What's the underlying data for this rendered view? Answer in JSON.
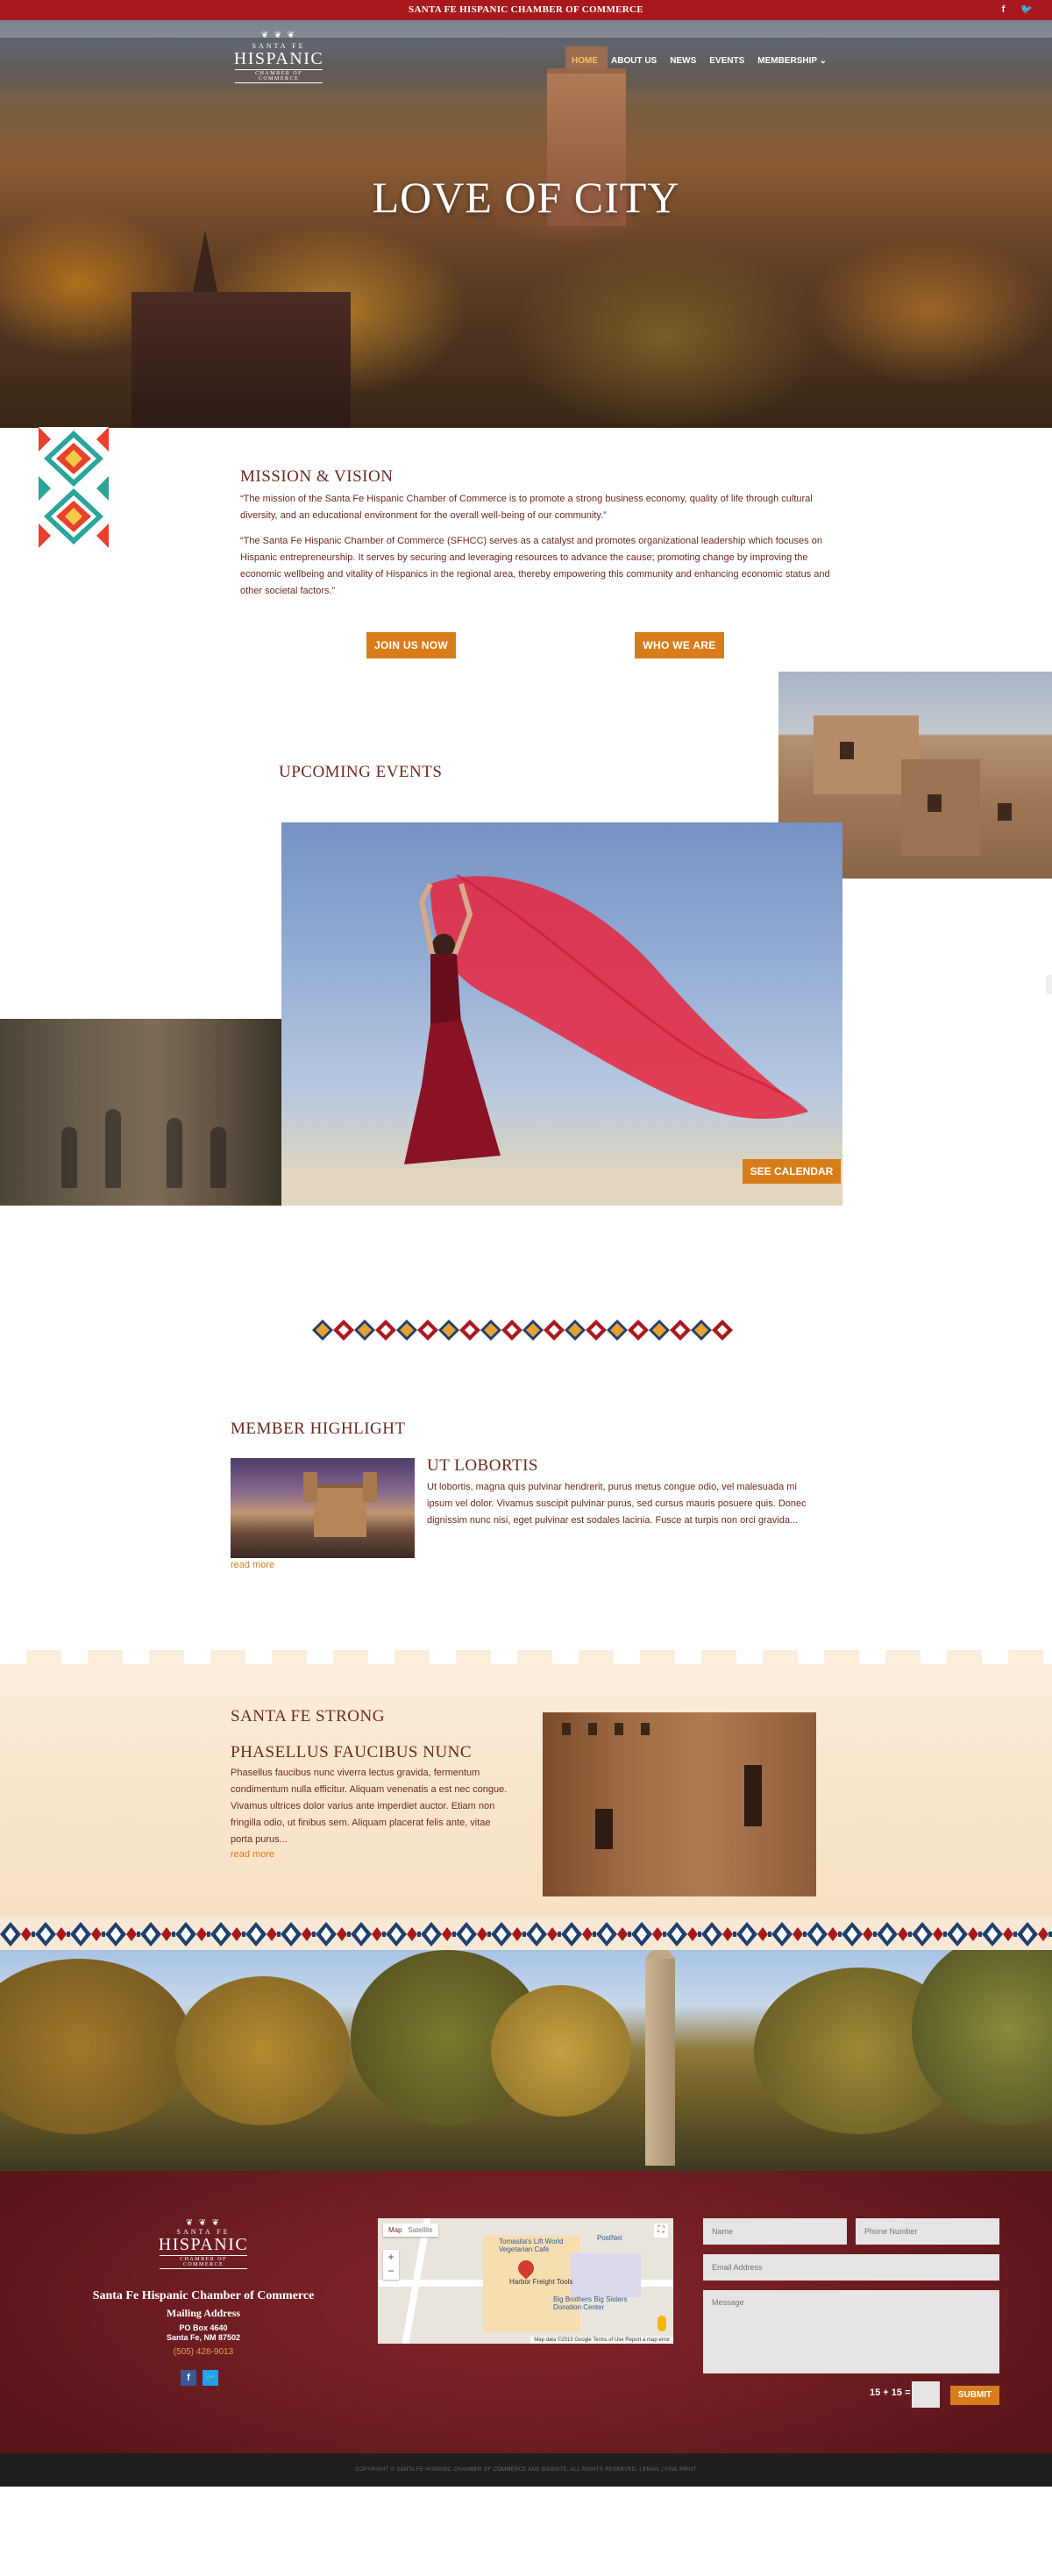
{
  "topbar": {
    "title": "SANTA FE HISPANIC CHAMBER OF COMMERCE",
    "facebook_icon": "f",
    "twitter_icon": "🐦"
  },
  "logo": {
    "ornament": "❦ ❦ ❦",
    "line1": "SANTA FE",
    "line2": "HISPANIC",
    "line3": "CHAMBER OF COMMERCE"
  },
  "nav": {
    "items": [
      "HOME",
      "ABOUT US",
      "NEWS",
      "EVENTS",
      "MEMBERSHIP ⌄"
    ],
    "active": 0
  },
  "hero": {
    "title": "LOVE OF CITY"
  },
  "mission": {
    "title": "MISSION & VISION",
    "p1": "“The mission of the Santa Fe Hispanic Chamber of Commerce is to promote a strong business economy, quality of life through cultural diversity, and an educational environment for the overall well-being of our community.”",
    "p2": "“The Santa Fe Hispanic Chamber of Commerce (SFHCC) serves as a catalyst and promotes organizational leadership which focuses on Hispanic entrepreneurship. It serves by securing and leveraging resources to advance the cause; promoting change by improving the economic wellbeing and vitality of Hispanics in the regional area, thereby empowering this community and enhancing economic status and other societal factors.”",
    "join_label": "JOIN US NOW",
    "who_label": "WHO WE ARE"
  },
  "events": {
    "title": "UPCOMING EVENTS",
    "calendar_label": "SEE CALENDAR"
  },
  "member": {
    "title": "MEMBER HIGHLIGHT",
    "name": "UT LOBORTIS",
    "text": "Ut lobortis, magna quis pulvinar hendrerit, purus metus congue odio, vel malesuada mi ipsum vel dolor. Vivamus suscipit pulvinar purus, sed cursus mauris posuere quis. Donec dignissim nunc nisi, eget pulvinar est sodales lacinia. Fusce at turpis non orci gravida...",
    "readmore": "read more"
  },
  "strong": {
    "title": "SANTA FE STRONG",
    "subtitle": "PHASELLUS FAUCIBUS NUNC",
    "text": "Phasellus faucibus nunc viverra lectus gravida, fermentum condimentum nulla efficitur. Aliquam venenatis a est nec congue. Vivamus ultrices dolor varius ante imperdiet auctor. Etiam non fringilla odio, ut finibus sem. Aliquam placerat felis ante, vitae porta purus...",
    "readmore": "read more"
  },
  "footer": {
    "org": "Santa Fe Hispanic Chamber of Commerce",
    "mailing": "Mailing Address",
    "po": "PO Box 4640",
    "city": "Santa Fe, NM 87502",
    "phone": "(505) 428-9013",
    "map": {
      "tab_map": "Map",
      "tab_sat": "Satellite",
      "poi1": "Harbor Freight Tools",
      "poi2": "PostNet",
      "poi3": "Tomasita's Lift World Vegetarian Cafe",
      "poi4": "Big Brothers Big Sisters Donation Center",
      "attribution": "Map data ©2019 Google   Terms of Use   Report a map error"
    },
    "form": {
      "name_ph": "Name",
      "phone_ph": "Phone Number",
      "email_ph": "Email Address",
      "message_ph": "Message",
      "captcha": "15 + 15 =",
      "submit": "SUBMIT"
    },
    "copyright": "COPYRIGHT © SANTA FE HISPANIC CHAMBER OF COMMERCE AND WEBSITE. ALL RIGHTS RESERVED. | EMAIL | FINE PRINT"
  },
  "colors": {
    "accent": "#d97d1b",
    "brand_red": "#a8191e",
    "text": "#6b2a1e",
    "footer": "#6e1d22"
  }
}
